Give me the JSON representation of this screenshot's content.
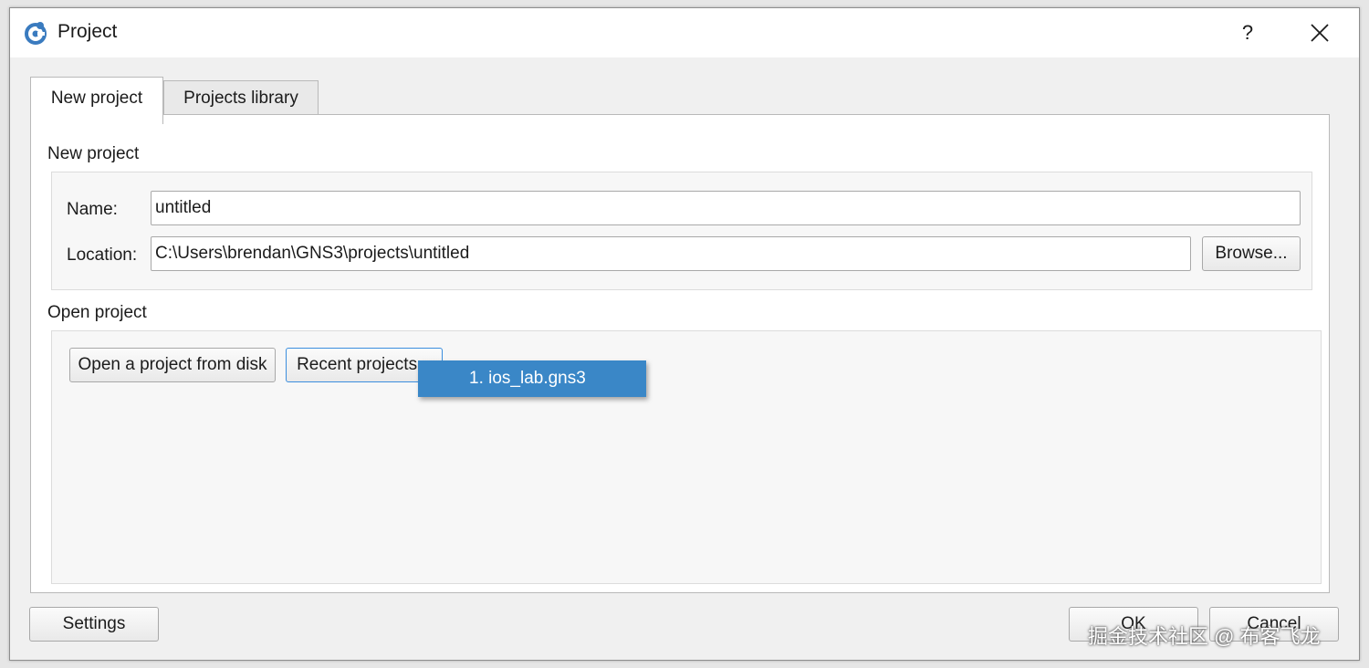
{
  "window": {
    "title": "Project",
    "help_label": "?",
    "close_label": "✕",
    "app_icon": "gns3-logo-icon"
  },
  "tabs": [
    {
      "label": "New project",
      "active": true
    },
    {
      "label": "Projects library",
      "active": false
    }
  ],
  "new_project": {
    "section_title": "New project",
    "name_label": "Name:",
    "name_value": "untitled",
    "location_label": "Location:",
    "location_value": "C:\\Users\\brendan\\GNS3\\projects\\untitled",
    "browse_label": "Browse..."
  },
  "open_project": {
    "section_title": "Open project",
    "open_from_disk_label": "Open a project from disk",
    "recent_projects_label": "Recent projects...",
    "recent_items": [
      "1. ios_lab.gns3"
    ]
  },
  "footer": {
    "settings_label": "Settings",
    "ok_label": "OK",
    "cancel_label": "Cancel"
  },
  "watermark": "掘金技术社区 @ 布客飞龙",
  "colors": {
    "accent": "#3a87c7",
    "focus_border": "#3b8ede",
    "window_bg": "#f0f0f0"
  }
}
